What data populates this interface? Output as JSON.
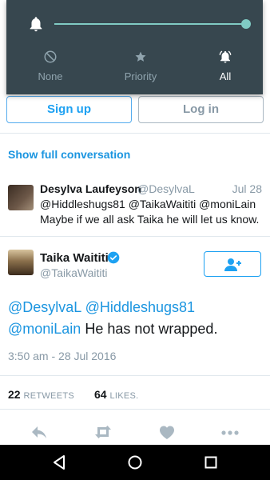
{
  "volume_panel": {
    "level": 1.0,
    "accent_color": "#80cbc4",
    "modes": [
      {
        "label": "None",
        "icon": "do-not-disturb-icon",
        "active": false
      },
      {
        "label": "Priority",
        "icon": "star-icon",
        "active": false
      },
      {
        "label": "All",
        "icon": "bell-icon",
        "active": true
      }
    ]
  },
  "auth": {
    "signup_label": "Sign up",
    "login_label": "Log in"
  },
  "conversation": {
    "show_full_label": "Show full conversation"
  },
  "reply_tweet": {
    "name": "Desylva Laufeyson",
    "handle": "@DesylvaL",
    "date": "Jul 28",
    "text": "@Hiddleshugs81 @TaikaWaititi @moniLain Maybe if we all ask Taika he will let us know."
  },
  "main_tweet": {
    "name": "Taika Waititi",
    "verified": true,
    "handle": "@TaikaWaititi",
    "mentions": [
      "@DesylvaL",
      "@Hiddleshugs81",
      "@moniLain"
    ],
    "text_rest": "He has not wrapped.",
    "timestamp": "3:50 am - 28 Jul 2016",
    "retweets_count": "22",
    "retweets_label": "RETWEETS",
    "likes_count": "64",
    "likes_label": "LIKES."
  },
  "colors": {
    "link": "#1b95e0",
    "muted": "#8899a6",
    "panel_bg": "#37474f"
  }
}
